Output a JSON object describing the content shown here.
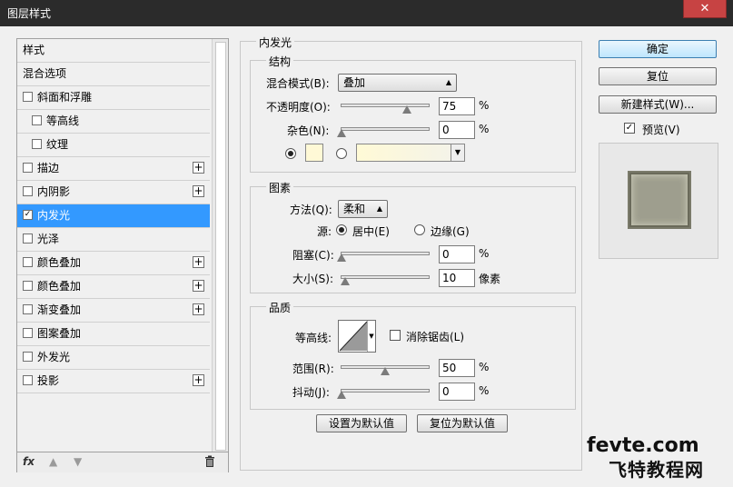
{
  "window": {
    "title": "图层样式",
    "close_glyph": "✕"
  },
  "left_panel": {
    "items": [
      {
        "label": "样式",
        "checkbox": false,
        "indent": false,
        "plus": false,
        "selected": false,
        "checked": false
      },
      {
        "label": "混合选项",
        "checkbox": false,
        "indent": false,
        "plus": false,
        "selected": false,
        "checked": false
      },
      {
        "label": "斜面和浮雕",
        "checkbox": true,
        "indent": false,
        "plus": false,
        "selected": false,
        "checked": false
      },
      {
        "label": "等高线",
        "checkbox": true,
        "indent": true,
        "plus": false,
        "selected": false,
        "checked": false
      },
      {
        "label": "纹理",
        "checkbox": true,
        "indent": true,
        "plus": false,
        "selected": false,
        "checked": false
      },
      {
        "label": "描边",
        "checkbox": true,
        "indent": false,
        "plus": true,
        "selected": false,
        "checked": false
      },
      {
        "label": "内阴影",
        "checkbox": true,
        "indent": false,
        "plus": true,
        "selected": false,
        "checked": false
      },
      {
        "label": "内发光",
        "checkbox": true,
        "indent": false,
        "plus": false,
        "selected": true,
        "checked": true
      },
      {
        "label": "光泽",
        "checkbox": true,
        "indent": false,
        "plus": false,
        "selected": false,
        "checked": false
      },
      {
        "label": "颜色叠加",
        "checkbox": true,
        "indent": false,
        "plus": true,
        "selected": false,
        "checked": false
      },
      {
        "label": "颜色叠加",
        "checkbox": true,
        "indent": false,
        "plus": true,
        "selected": false,
        "checked": false
      },
      {
        "label": "渐变叠加",
        "checkbox": true,
        "indent": false,
        "plus": true,
        "selected": false,
        "checked": false
      },
      {
        "label": "图案叠加",
        "checkbox": true,
        "indent": false,
        "plus": false,
        "selected": false,
        "checked": false
      },
      {
        "label": "外发光",
        "checkbox": true,
        "indent": false,
        "plus": false,
        "selected": false,
        "checked": false
      },
      {
        "label": "投影",
        "checkbox": true,
        "indent": false,
        "plus": true,
        "selected": false,
        "checked": false
      }
    ],
    "footer": {
      "fx": "fx",
      "up_icon": "arrow-up",
      "down_icon": "arrow-down",
      "trash_icon": "trash"
    }
  },
  "inner_glow": {
    "title": "内发光",
    "structure": {
      "title": "结构",
      "blend_mode_label": "混合模式(B):",
      "blend_mode_value": "叠加",
      "opacity_label": "不透明度(O):",
      "opacity_value": "75",
      "opacity_unit": "%",
      "opacity_level": 0.75,
      "noise_label": "杂色(N):",
      "noise_value": "0",
      "noise_unit": "%",
      "noise_level": 0,
      "glow_color": "#fff9d6",
      "mode": "color"
    },
    "elements": {
      "title": "图素",
      "method_label": "方法(Q):",
      "method_value": "柔和",
      "source_label": "源:",
      "center_label": "居中(E)",
      "edge_label": "边缘(G)",
      "source_value": "center",
      "choke_label": "阻塞(C):",
      "choke_value": "0",
      "choke_unit": "%",
      "choke_level": 0,
      "size_label": "大小(S):",
      "size_value": "10",
      "size_unit": "像素",
      "size_level": 0.04
    },
    "quality": {
      "title": "品质",
      "contour_label": "等高线:",
      "antialias_label": "消除锯齿(L)",
      "antialias_checked": false,
      "range_label": "范围(R):",
      "range_value": "50",
      "range_unit": "%",
      "range_level": 0.5,
      "jitter_label": "抖动(J):",
      "jitter_value": "0",
      "jitter_unit": "%",
      "jitter_level": 0
    },
    "make_default_label": "设置为默认值",
    "reset_default_label": "复位为默认值"
  },
  "right_panel": {
    "ok_label": "确定",
    "reset_label": "复位",
    "new_style_label": "新建样式(W)...",
    "preview_label": "预览(V)",
    "preview_checked": true
  },
  "watermark": {
    "line1": "fevte.com",
    "line2": "飞特教程网"
  }
}
